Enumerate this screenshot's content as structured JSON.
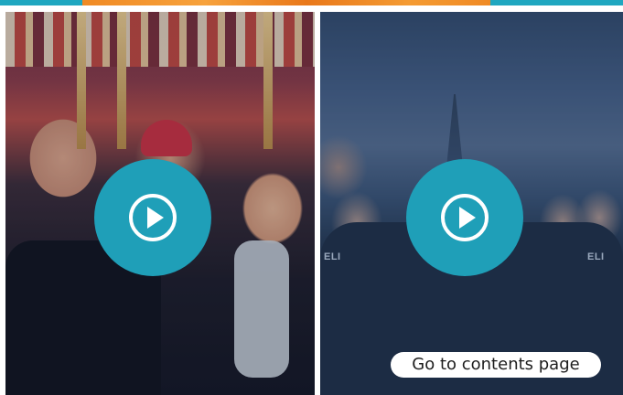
{
  "banner": {
    "accent_color": "#1fa7c0",
    "photo_tint": "#f08a24"
  },
  "video_cards": [
    {
      "icon": "play-icon",
      "button_color": "#1f9fb8"
    },
    {
      "icon": "play-icon",
      "button_color": "#1f9fb8",
      "logo_text": "ELI"
    }
  ],
  "contents_link": {
    "label": "Go to contents page"
  }
}
